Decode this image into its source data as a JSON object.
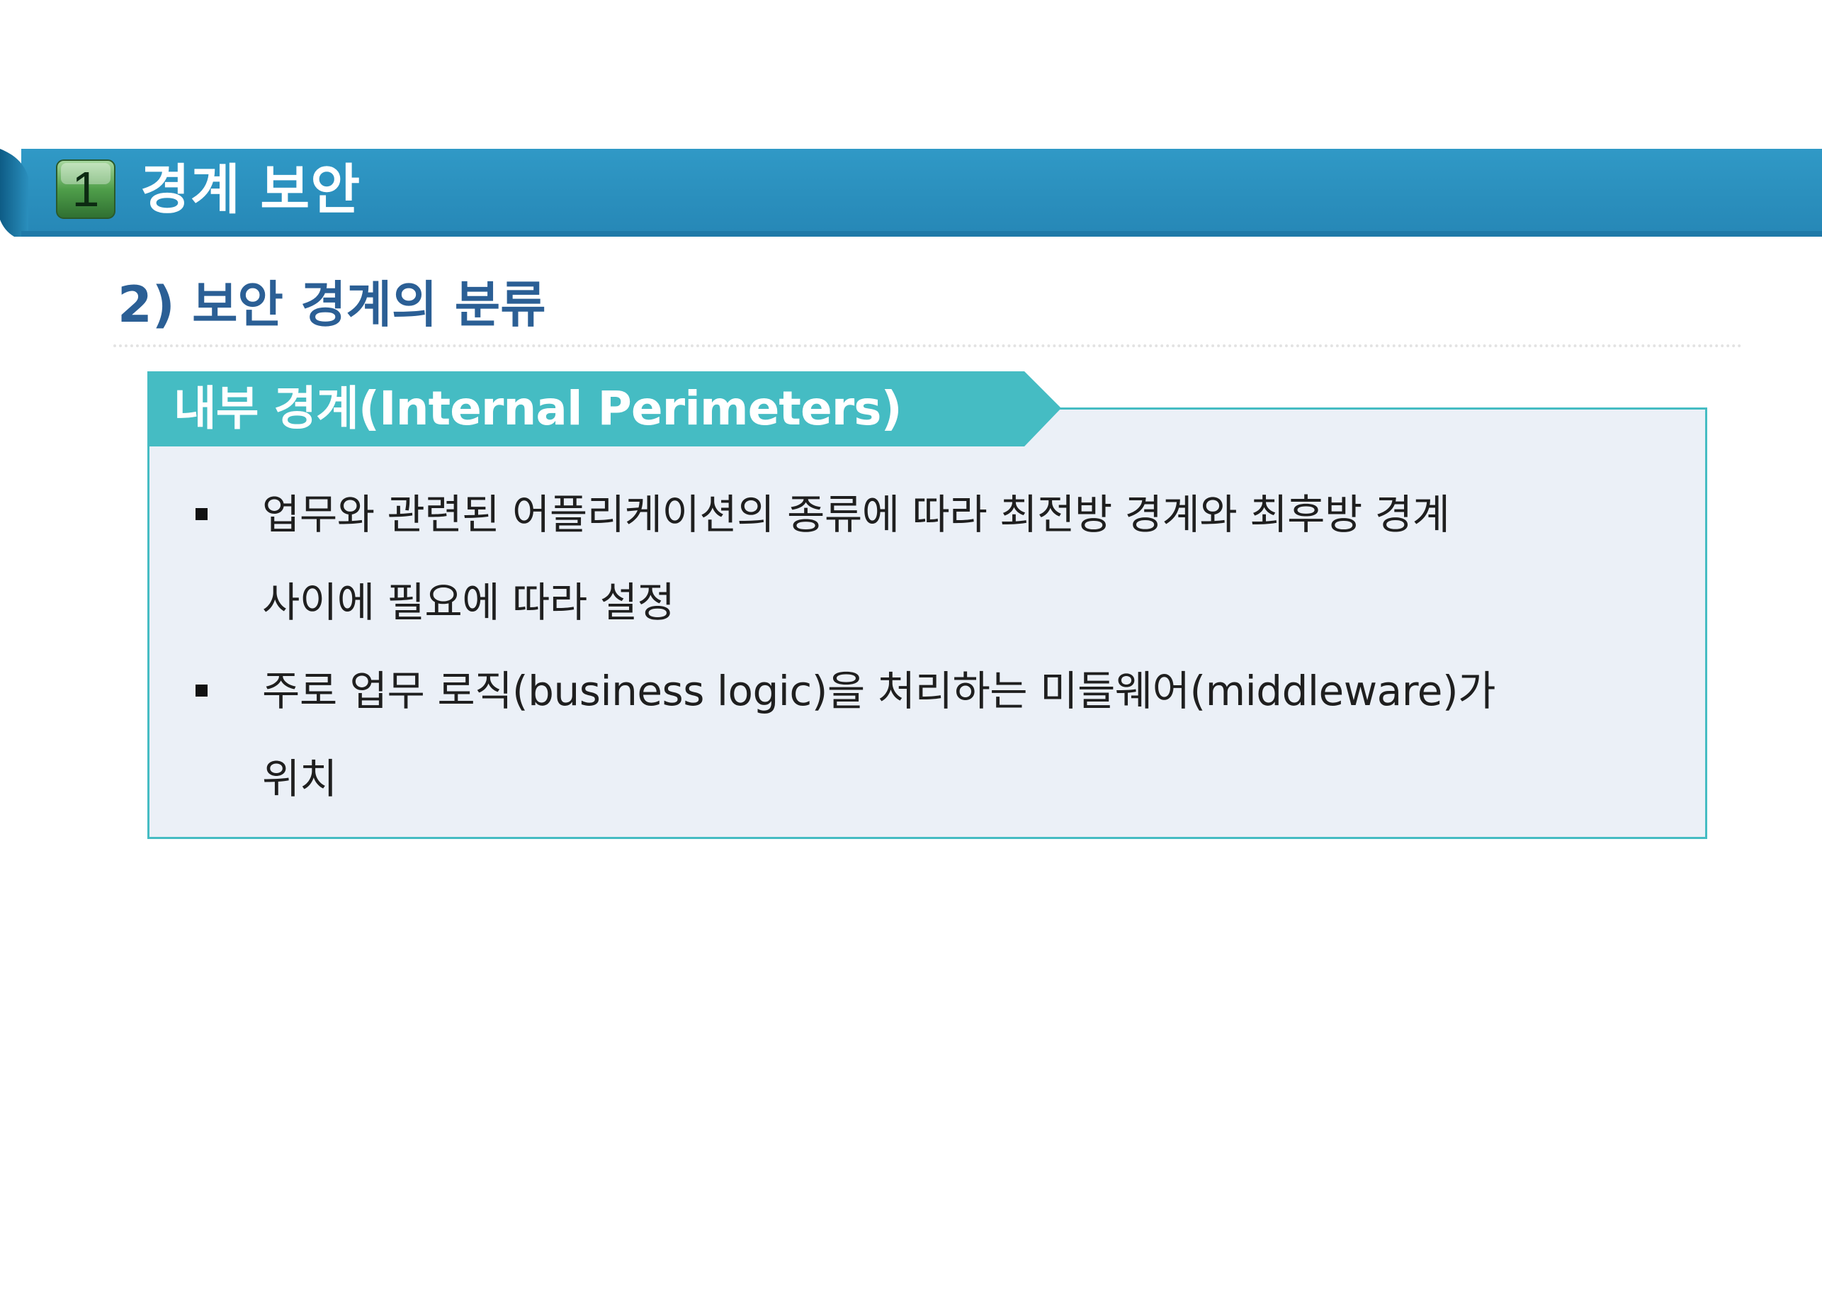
{
  "section": {
    "number": "1",
    "title": "경계 보안"
  },
  "subtitle": "2) 보안 경계의 분류",
  "box": {
    "heading": "내부 경계(Internal Perimeters)",
    "bullets": [
      {
        "lines": [
          "업무와 관련된 어플리케이션의 종류에 따라 최전방 경계와 최후방 경계",
          "사이에 필요에 따라 설정"
        ]
      },
      {
        "lines": [
          "주로 업무 로직(business logic)을 처리하는 미들웨어(middleware)가",
          "위치"
        ]
      }
    ]
  },
  "colors": {
    "banner": "#2a8fbd",
    "banner_dark": "#1a6f9b",
    "badge": "#3d8a3f",
    "subtitle": "#2b5f95",
    "heading_tab": "#45bcc3",
    "box_fill": "#ebf0f7",
    "box_border": "#45bcc3"
  }
}
